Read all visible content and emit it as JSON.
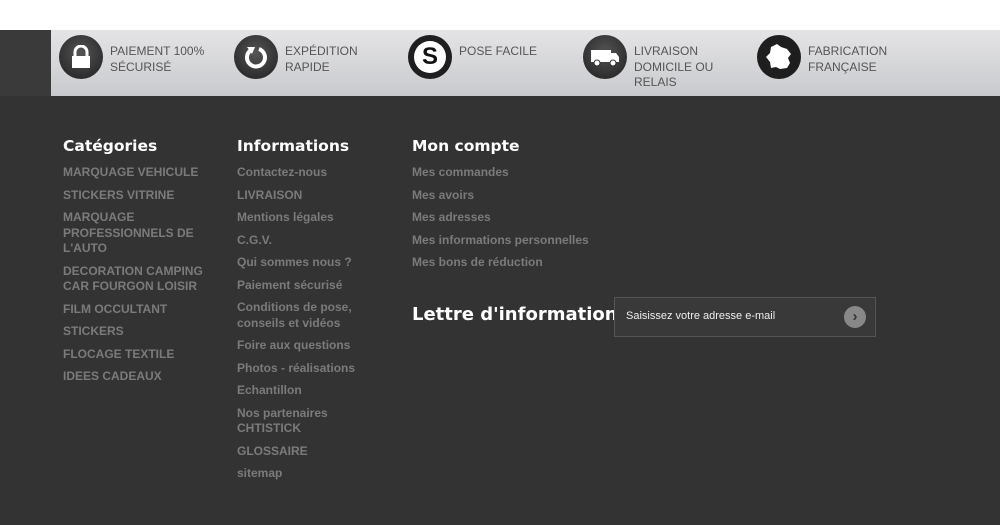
{
  "features": [
    {
      "icon": "lock-icon",
      "label": "PAIEMENT 100% SÉCURISÉ"
    },
    {
      "icon": "refresh-icon",
      "label": "EXPÉDITION RAPIDE"
    },
    {
      "icon": "s-logo-icon",
      "label": "POSE FACILE"
    },
    {
      "icon": "truck-icon",
      "label": "LIVRAISON DOMICILE OU RELAIS"
    },
    {
      "icon": "france-map-icon",
      "label": "FABRICATION FRANÇAISE"
    }
  ],
  "categories": {
    "title": "Catégories",
    "items": [
      "MARQUAGE VEHICULE",
      "STICKERS VITRINE",
      "MARQUAGE PROFESSIONNELS DE L'AUTO",
      "DECORATION CAMPING CAR FOURGON LOISIR",
      "FILM OCCULTANT",
      "STICKERS",
      "FLOCAGE TEXTILE",
      "IDEES CADEAUX"
    ]
  },
  "informations": {
    "title": "Informations",
    "items": [
      "Contactez-nous",
      "LIVRAISON",
      "Mentions légales",
      "C.G.V.",
      "Qui sommes nous ?",
      "Paiement sécurisé",
      "Conditions de pose, conseils et vidéos",
      "Foire aux questions",
      "Photos - réalisations",
      "Echantillon",
      "Nos partenaires CHTISTICK",
      "GLOSSAIRE",
      "sitemap"
    ]
  },
  "account": {
    "title": "Mon compte",
    "items": [
      "Mes commandes",
      "Mes avoirs",
      "Mes adresses",
      "Mes informations personnelles",
      "Mes bons de réduction"
    ]
  },
  "newsletter": {
    "title": "Lettre d'informations",
    "placeholder": "Saisissez votre adresse e-mail",
    "submit": "›"
  }
}
